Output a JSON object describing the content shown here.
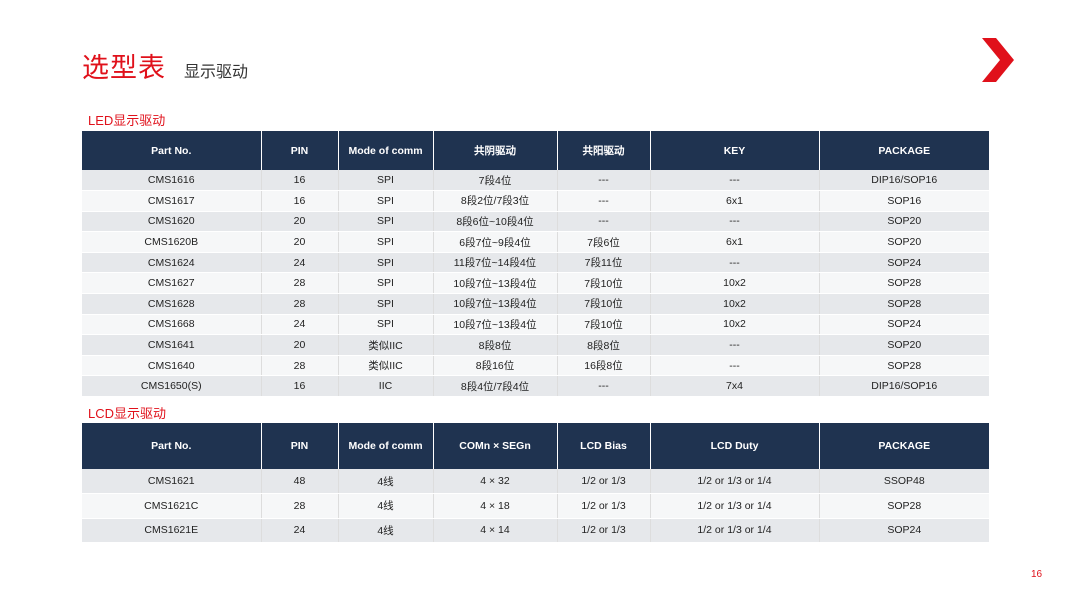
{
  "header": {
    "title": "选型表",
    "subtitle": "显示驱动"
  },
  "brand": {
    "accent": "#e0111b",
    "header_bg": "#1f3350"
  },
  "led": {
    "label": "LED显示驱动",
    "columns": [
      "Part No.",
      "PIN",
      "Mode of comm",
      "共阴驱动",
      "共阳驱动",
      "KEY",
      "PACKAGE"
    ],
    "rows": [
      [
        "CMS1616",
        "16",
        "SPI",
        "7段4位",
        "---",
        "---",
        "DIP16/SOP16"
      ],
      [
        "CMS1617",
        "16",
        "SPI",
        "8段2位/7段3位",
        "---",
        "6x1",
        "SOP16"
      ],
      [
        "CMS1620",
        "20",
        "SPI",
        "8段6位~10段4位",
        "---",
        "---",
        "SOP20"
      ],
      [
        "CMS1620B",
        "20",
        "SPI",
        "6段7位~9段4位",
        "7段6位",
        "6x1",
        "SOP20"
      ],
      [
        "CMS1624",
        "24",
        "SPI",
        "11段7位~14段4位",
        "7段11位",
        "---",
        "SOP24"
      ],
      [
        "CMS1627",
        "28",
        "SPI",
        "10段7位~13段4位",
        "7段10位",
        "10x2",
        "SOP28"
      ],
      [
        "CMS1628",
        "28",
        "SPI",
        "10段7位~13段4位",
        "7段10位",
        "10x2",
        "SOP28"
      ],
      [
        "CMS1668",
        "24",
        "SPI",
        "10段7位~13段4位",
        "7段10位",
        "10x2",
        "SOP24"
      ],
      [
        "CMS1641",
        "20",
        "类似IIC",
        "8段8位",
        "8段8位",
        "---",
        "SOP20"
      ],
      [
        "CMS1640",
        "28",
        "类似IIC",
        "8段16位",
        "16段8位",
        "---",
        "SOP28"
      ],
      [
        "CMS1650(S)",
        "16",
        "IIC",
        "8段4位/7段4位",
        "---",
        "7x4",
        "DIP16/SOP16"
      ]
    ]
  },
  "lcd": {
    "label": "LCD显示驱动",
    "columns": [
      "Part No.",
      "PIN",
      "Mode of comm",
      "COMn × SEGn",
      "LCD Bias",
      "LCD Duty",
      "PACKAGE"
    ],
    "rows": [
      [
        "CMS1621",
        "48",
        "4线",
        "4 × 32",
        "1/2 or 1/3",
        "1/2 or 1/3 or 1/4",
        "SSOP48"
      ],
      [
        "CMS1621C",
        "28",
        "4线",
        "4 × 18",
        "1/2 or 1/3",
        "1/2 or 1/3 or 1/4",
        "SOP28"
      ],
      [
        "CMS1621E",
        "24",
        "4线",
        "4 × 14",
        "1/2 or 1/3",
        "1/2 or 1/3 or 1/4",
        "SOP24"
      ]
    ]
  },
  "footer": {
    "page_number": "16"
  }
}
